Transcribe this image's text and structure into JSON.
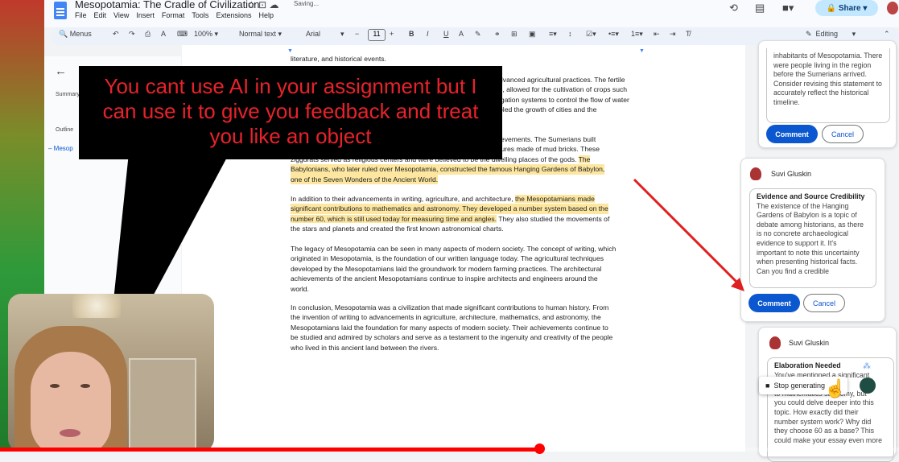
{
  "app": {
    "doc_title": "Mesopotamia: The Cradle of Civilization",
    "saving": "Saving...",
    "menus": [
      "File",
      "Edit",
      "View",
      "Insert",
      "Format",
      "Tools",
      "Extensions",
      "Help"
    ],
    "share_label": "Share"
  },
  "toolbar": {
    "search_label": "Menus",
    "zoom": "100%",
    "style": "Normal text",
    "font": "Arial",
    "font_size": "11",
    "mode": "Editing"
  },
  "left_panel": {
    "summary_label": "Summary",
    "outline_label": "Outline",
    "outline_item": "Mesop"
  },
  "document": {
    "line_top": "literature, and historical events.",
    "p1_tail": [
      "dvanced agricultural practices. The fertile",
      "s, allowed for the cultivation of crops such",
      "igation systems to control the flow of water",
      "bled the growth of cities and the"
    ],
    "p2_tail_1": "ievements. The Sumerians built",
    "p2_tail_2": "tures made of mud bricks. These",
    "p2_line3": "ziggurats served as religious centers and were believed to be the dwelling places of the gods.",
    "p2_highlight_a": "The",
    "p2_line4": "Babylonians, who later ruled over Mesopotamia, constructed the famous Hanging Gardens of Babylon,",
    "p2_line5": "one of the Seven Wonders of the Ancient World.",
    "p3_line1_plain": "In addition to their advancements in writing, agriculture, and architecture,",
    "p3_line1_hl": "the Mesopotamians made",
    "p3_line2": "significant contributions to mathematics and astronomy. They developed a number system based on the",
    "p3_line3_hl": "number 60, which is still used today for measuring time and angles.",
    "p3_line3_plain": "They also studied the movements of",
    "p3_line4": "the stars and planets and created the first known astronomical charts.",
    "p4": [
      "The legacy of Mesopotamia can be seen in many aspects of modern society. The concept of writing, which",
      "originated in Mesopotamia, is the foundation of our written language today. The agricultural techniques",
      "developed by the Mesopotamians laid the groundwork for modern farming practices. The architectural",
      "achievements of the ancient Mesopotamians continue to inspire architects and engineers around the",
      "world."
    ],
    "p5": [
      "In conclusion, Mesopotamia was a civilization that made significant contributions to human history. From",
      "the invention of writing to advancements in agriculture, architecture, mathematics, and astronomy, the",
      "Mesopotamians laid the foundation for many aspects of modern society. Their achievements continue to",
      "be studied and admired by scholars and serve as a testament to the ingenuity and creativity of the people",
      "who lived in this ancient land between the rivers."
    ]
  },
  "comments": {
    "c1_lines": [
      "inhabitants of Mesopotamia. There",
      "were people living in the region",
      "before the Sumerians arrived.",
      "Consider revising this statement to",
      "accurately reflect the historical",
      "timeline."
    ],
    "c1_comment": "Comment",
    "c1_cancel": "Cancel",
    "c2_author": "Suvi Gluskin",
    "c2_title": "Evidence and Source Credibility",
    "c2_lines": [
      "The existence of the Hanging",
      "Gardens of Babylon is a topic of",
      "debate among historians, as there",
      "is no concrete archaeological",
      "evidence to support it. It's",
      "important to note this uncertainty",
      "when presenting historical facts.",
      "Can you find a credible"
    ],
    "c2_comment": "Comment",
    "c2_cancel": "Cancel",
    "c3_author": "Suvi Gluskin",
    "c3_title": "Elaboration Needed",
    "c3_lines": [
      "You've mentioned a significant",
      "                 bylonians",
      "to mathematics         stronomy, but",
      "you could delve deeper into this",
      "topic. How exactly did their",
      "number system work? Why did",
      "they choose 60 as a base? This",
      "could make your essay even more"
    ],
    "stop_label": "Stop generating"
  },
  "overlay": {
    "speech_text": "You cant use AI in your assignment but I can use it to give you feedback and treat you like an object"
  },
  "video": {
    "progress": 0.6
  }
}
